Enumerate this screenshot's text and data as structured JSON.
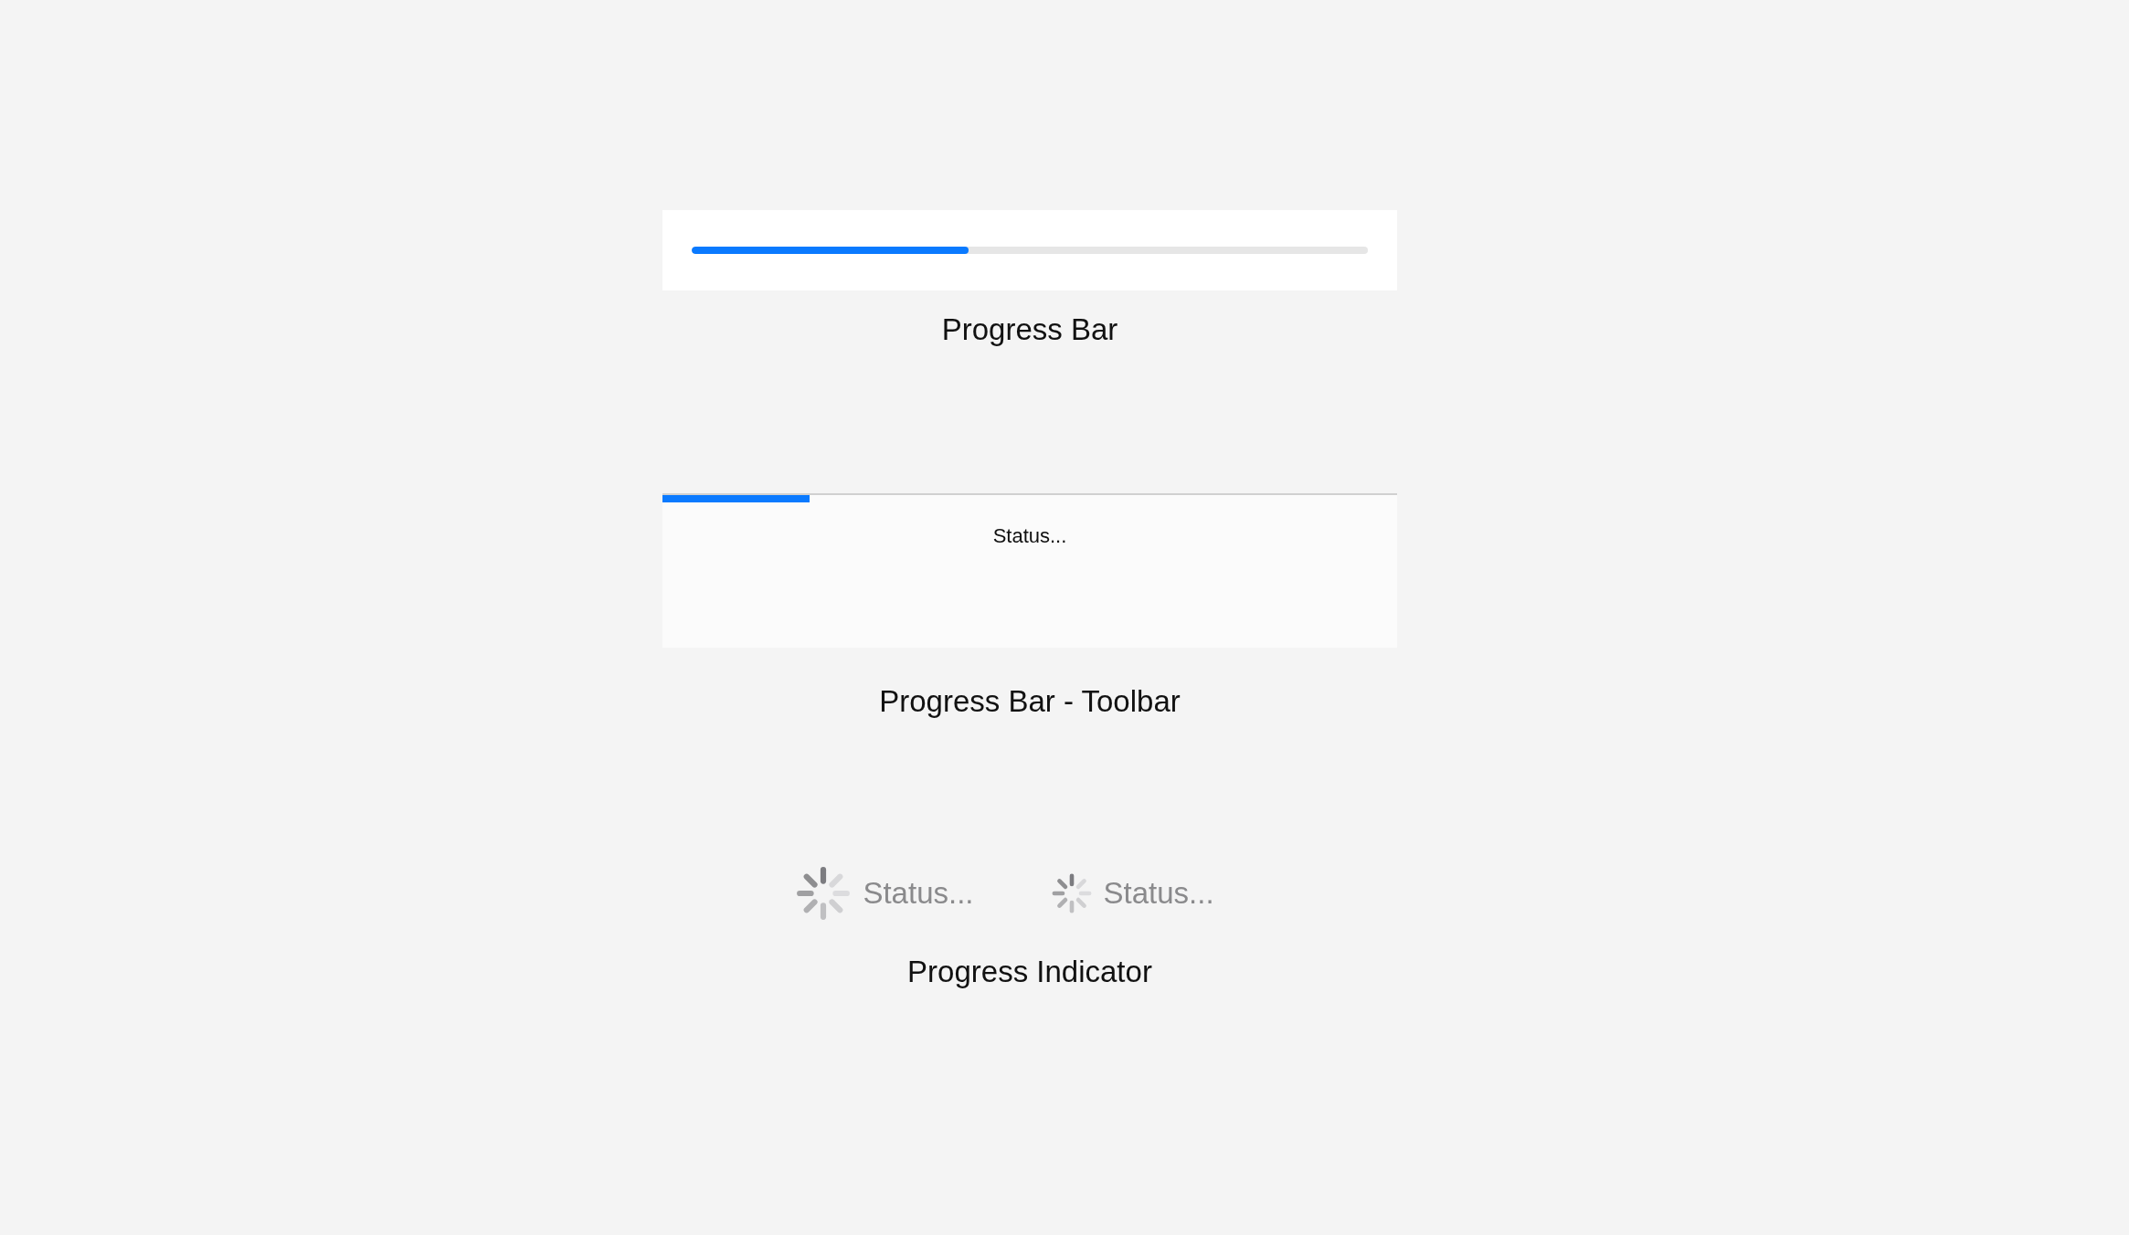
{
  "sections": [
    {
      "kind": "bar",
      "level": 0.41,
      "caption": "Progress Bar"
    },
    {
      "kind": "toolbar",
      "level": 0.2,
      "status": "Status...",
      "caption": "Progress Bar - Toolbar"
    },
    {
      "kind": "indicators",
      "indicators": [
        {
          "kind": "large",
          "status": "Status..."
        },
        {
          "kind": "small",
          "status": "Status..."
        }
      ],
      "caption": "Progress Indicator"
    }
  ]
}
